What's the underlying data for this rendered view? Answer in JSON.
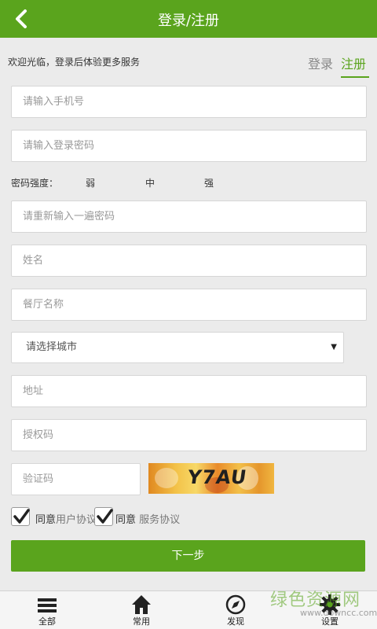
{
  "header": {
    "title": "登录/注册"
  },
  "intro": {
    "welcome": "欢迎光临，登录后体验更多服务"
  },
  "tabs": {
    "login": "登录",
    "register": "注册"
  },
  "form": {
    "phone_placeholder": "请输入手机号",
    "password_placeholder": "请输入登录密码",
    "strength": {
      "label": "密码强度：",
      "weak": "弱",
      "medium": "中",
      "strong": "强"
    },
    "repeat_placeholder": "请重新输入一遍密码",
    "name_placeholder": "姓名",
    "restaurant_placeholder": "餐厅名称",
    "city_selected": "请选择城市",
    "address_placeholder": "地址",
    "auth_code_placeholder": "授权码",
    "captcha_placeholder": "验证码",
    "captcha_text": "Y7AU"
  },
  "agreements": {
    "agree1_prefix": "同意",
    "agree1_link": "用户协议",
    "agree1_checked": true,
    "agree2_prefix": "同意",
    "agree2_link": "服务协议",
    "agree2_checked": true
  },
  "actions": {
    "next_label": "下一步"
  },
  "bottom_nav": {
    "items": [
      {
        "label": "全部",
        "icon": "menu-icon"
      },
      {
        "label": "常用",
        "icon": "home-icon"
      },
      {
        "label": "发现",
        "icon": "compass-icon"
      },
      {
        "label": "设置",
        "icon": "gear-icon"
      }
    ]
  },
  "watermark": {
    "text": "绿色资源网",
    "url": "www.downcc.com"
  },
  "colors": {
    "brand": "#5aa41d",
    "background": "#ebebeb"
  }
}
